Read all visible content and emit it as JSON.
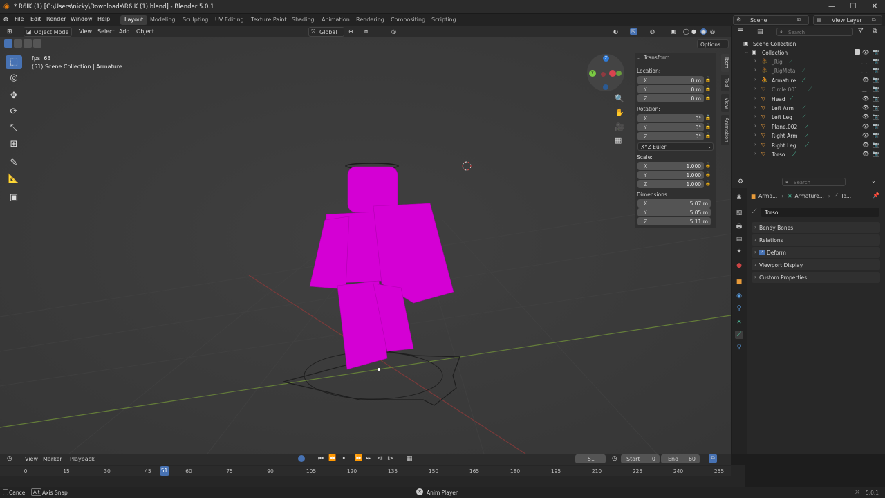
{
  "window": {
    "title": "* R6IK (1) [C:\\Users\\nicky\\Downloads\\R6IK (1).blend] - Blender 5.0.1",
    "controls": [
      "—",
      "☐",
      "✕"
    ]
  },
  "menu": {
    "items": [
      "File",
      "Edit",
      "Render",
      "Window",
      "Help"
    ],
    "workspaces": [
      "Layout",
      "Modeling",
      "Sculpting",
      "UV Editing",
      "Texture Paint",
      "Shading",
      "Animation",
      "Rendering",
      "Compositing",
      "Scripting"
    ],
    "active_workspace": "Layout",
    "add_tab": "+",
    "scene_label": "Scene",
    "view_layer_label": "View Layer"
  },
  "viewport": {
    "mode": "Object Mode",
    "menus": [
      "View",
      "Select",
      "Add",
      "Object"
    ],
    "orientation": "Global",
    "options_label": "Options",
    "overlay_lines": [
      "fps: 63",
      "(51) Scene Collection | Armature"
    ],
    "gizmo": {
      "z": "Z",
      "y": "Y",
      "x": ""
    }
  },
  "npanel": {
    "header": "Transform",
    "location_label": "Location:",
    "location": [
      {
        "axis": "X",
        "value": "0 m"
      },
      {
        "axis": "Y",
        "value": "0 m"
      },
      {
        "axis": "Z",
        "value": "0 m"
      }
    ],
    "rotation_label": "Rotation:",
    "rotation": [
      {
        "axis": "X",
        "value": "0°"
      },
      {
        "axis": "Y",
        "value": "0°"
      },
      {
        "axis": "Z",
        "value": "0°"
      }
    ],
    "rotation_mode": "XYZ Euler",
    "scale_label": "Scale:",
    "scale": [
      {
        "axis": "X",
        "value": "1.000"
      },
      {
        "axis": "Y",
        "value": "1.000"
      },
      {
        "axis": "Z",
        "value": "1.000"
      }
    ],
    "dimensions_label": "Dimensions:",
    "dimensions": [
      {
        "axis": "X",
        "value": "5.07 m"
      },
      {
        "axis": "Y",
        "value": "5.05 m"
      },
      {
        "axis": "Z",
        "value": "5.11 m"
      }
    ],
    "tabs": [
      "Item",
      "Tool",
      "View",
      "Animation"
    ]
  },
  "outliner": {
    "search_placeholder": "Search",
    "scene_collection": "Scene Collection",
    "collection": "Collection",
    "items": [
      {
        "name": "_Rig",
        "dim": true
      },
      {
        "name": "_RigMeta",
        "dim": true
      },
      {
        "name": "Armature",
        "dim": false
      },
      {
        "name": "Circle.001",
        "dim": true
      },
      {
        "name": "Head",
        "dim": false
      },
      {
        "name": "Left Arm",
        "dim": false
      },
      {
        "name": "Left Leg",
        "dim": false
      },
      {
        "name": "Plane.002",
        "dim": false
      },
      {
        "name": "Right Arm",
        "dim": false
      },
      {
        "name": "Right Leg",
        "dim": false
      },
      {
        "name": "Torso",
        "dim": false
      }
    ]
  },
  "properties": {
    "search_placeholder": "Search",
    "breadcrumb": [
      "Arma...",
      "Armature...",
      "To..."
    ],
    "bone_name": "Torso",
    "panels": [
      "Bendy Bones",
      "Relations",
      "Deform",
      "Viewport Display",
      "Custom Properties"
    ],
    "deform_checked": true
  },
  "timeline": {
    "menus": [
      "View",
      "Marker",
      "Playback"
    ],
    "current_frame": "51",
    "start_label": "Start",
    "start": "0",
    "end_label": "End",
    "end": "60",
    "ticks": [
      "0",
      "15",
      "30",
      "45",
      "60",
      "75",
      "90",
      "105",
      "120",
      "135",
      "150",
      "165",
      "180",
      "195",
      "210",
      "225",
      "240",
      "255"
    ],
    "playhead": "51"
  },
  "status": {
    "left_key1": "Cancel",
    "left_key2": "Alt",
    "left_action2": "Axis Snap",
    "center": "Anim Player",
    "version": "5.0.1"
  }
}
